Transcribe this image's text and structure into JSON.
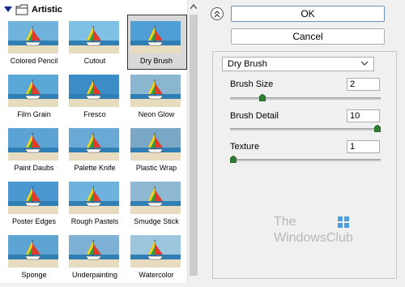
{
  "gallery": {
    "category": "Artistic",
    "filters": [
      {
        "label": "Colored Pencil",
        "selected": false
      },
      {
        "label": "Cutout",
        "selected": false
      },
      {
        "label": "Dry Brush",
        "selected": true
      },
      {
        "label": "Film Grain",
        "selected": false
      },
      {
        "label": "Fresco",
        "selected": false
      },
      {
        "label": "Neon Glow",
        "selected": false
      },
      {
        "label": "Paint Daubs",
        "selected": false
      },
      {
        "label": "Palette Knife",
        "selected": false
      },
      {
        "label": "Plastic Wrap",
        "selected": false
      },
      {
        "label": "Poster Edges",
        "selected": false
      },
      {
        "label": "Rough Pastels",
        "selected": false
      },
      {
        "label": "Smudge Stick",
        "selected": false
      },
      {
        "label": "Sponge",
        "selected": false
      },
      {
        "label": "Underpainting",
        "selected": false
      },
      {
        "label": "Watercolor",
        "selected": false
      }
    ]
  },
  "buttons": {
    "ok": "OK",
    "cancel": "Cancel"
  },
  "settings": {
    "filter_select": "Dry Brush",
    "params": [
      {
        "label": "Brush Size",
        "value": "2",
        "min": 0,
        "max": 10,
        "level": 2
      },
      {
        "label": "Brush Detail",
        "value": "10",
        "min": 0,
        "max": 10,
        "level": 10
      },
      {
        "label": "Texture",
        "value": "1",
        "min": 1,
        "max": 3,
        "level": 1
      }
    ]
  },
  "watermark": {
    "line1": "The",
    "line2": "WindowsClub"
  },
  "colors": {
    "selection_border": "#333333",
    "primary_border": "#6b8fb8",
    "slider_thumb": "#2e7d32"
  }
}
